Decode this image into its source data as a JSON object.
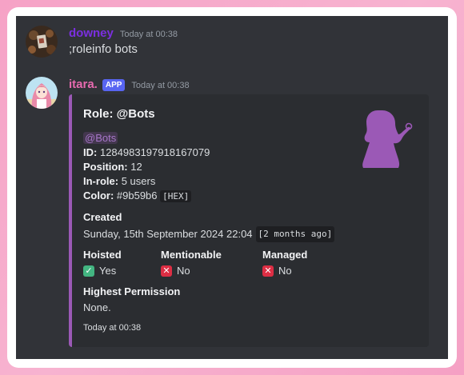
{
  "messages": [
    {
      "username": "downey",
      "username_color": "#7b2fe0",
      "timestamp": "Today at 00:38",
      "text": ";roleinfo bots"
    },
    {
      "username": "itara.",
      "username_color": "#e86ab0",
      "badge": "APP",
      "timestamp": "Today at 00:38"
    }
  ],
  "embed": {
    "accent_color": "#9b59b6",
    "title": "Role: @Bots",
    "mention": "@Bots",
    "id_label": "ID:",
    "id_value": "1284983197918167079",
    "position_label": "Position:",
    "position_value": "12",
    "inrole_label": "In-role:",
    "inrole_value": "5 users",
    "color_label": "Color:",
    "color_value": "#9b59b6",
    "color_code": "[HEX]",
    "created_label": "Created",
    "created_value": "Sunday, 15th September 2024 22:04",
    "created_code": "[2 months ago]",
    "hoisted_label": "Hoisted",
    "hoisted_value": "Yes",
    "mentionable_label": "Mentionable",
    "mentionable_value": "No",
    "managed_label": "Managed",
    "managed_value": "No",
    "highest_perm_label": "Highest Permission",
    "highest_perm_value": "None.",
    "footer": "Today at 00:38"
  },
  "icons": {
    "check": "white-check-mark-icon",
    "cross": "cross-mark-icon",
    "thumbnail": "girl-silhouette-icon"
  }
}
